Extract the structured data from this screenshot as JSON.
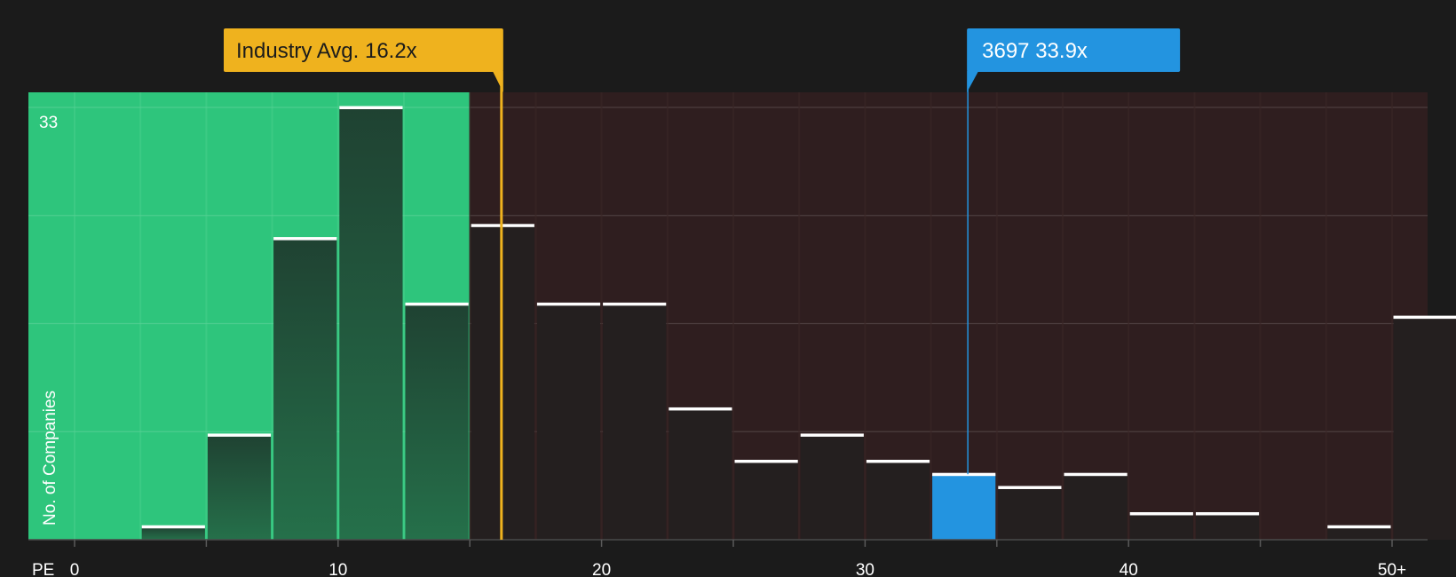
{
  "chart_data": {
    "type": "bar",
    "x_axis_label": "PE",
    "y_axis_label": "No. of Companies",
    "y_max_label": "33",
    "ylim": [
      0,
      33
    ],
    "x_ticks": [
      "0",
      "10",
      "20",
      "30",
      "40",
      "50+"
    ],
    "bins": [
      {
        "from": 0,
        "to": 2.5,
        "count": 0
      },
      {
        "from": 2.5,
        "to": 5,
        "count": 1
      },
      {
        "from": 5,
        "to": 7.5,
        "count": 8
      },
      {
        "from": 7.5,
        "to": 10,
        "count": 23
      },
      {
        "from": 10,
        "to": 12.5,
        "count": 33
      },
      {
        "from": 12.5,
        "to": 15,
        "count": 18
      },
      {
        "from": 15,
        "to": 17.5,
        "count": 24
      },
      {
        "from": 17.5,
        "to": 20,
        "count": 18
      },
      {
        "from": 20,
        "to": 22.5,
        "count": 18
      },
      {
        "from": 22.5,
        "to": 25,
        "count": 10
      },
      {
        "from": 25,
        "to": 27.5,
        "count": 6
      },
      {
        "from": 27.5,
        "to": 30,
        "count": 8
      },
      {
        "from": 30,
        "to": 32.5,
        "count": 6
      },
      {
        "from": 32.5,
        "to": 35,
        "count": 5
      },
      {
        "from": 35,
        "to": 37.5,
        "count": 4
      },
      {
        "from": 37.5,
        "to": 40,
        "count": 5
      },
      {
        "from": 40,
        "to": 42.5,
        "count": 2
      },
      {
        "from": 42.5,
        "to": 45,
        "count": 2
      },
      {
        "from": 45,
        "to": 47.5,
        "count": 0
      },
      {
        "from": 47.5,
        "to": 50,
        "count": 1
      },
      {
        "from": 50,
        "to": 52.5,
        "count": 17
      }
    ],
    "industry_average": {
      "value": 16.2,
      "label": "Industry Avg. 16.2x"
    },
    "company": {
      "value": 33.9,
      "label": "3697 33.9x"
    },
    "colors": {
      "background": "#1b1b1b",
      "undervalued_region": "#2ec57c",
      "overvalued_region": "#2f1e1f",
      "bar_in_green": "#1e3d30",
      "bar_in_red": "#241f1f",
      "bar_top": "#ffffff",
      "industry": "#efb21e",
      "company": "#2394e0"
    }
  }
}
